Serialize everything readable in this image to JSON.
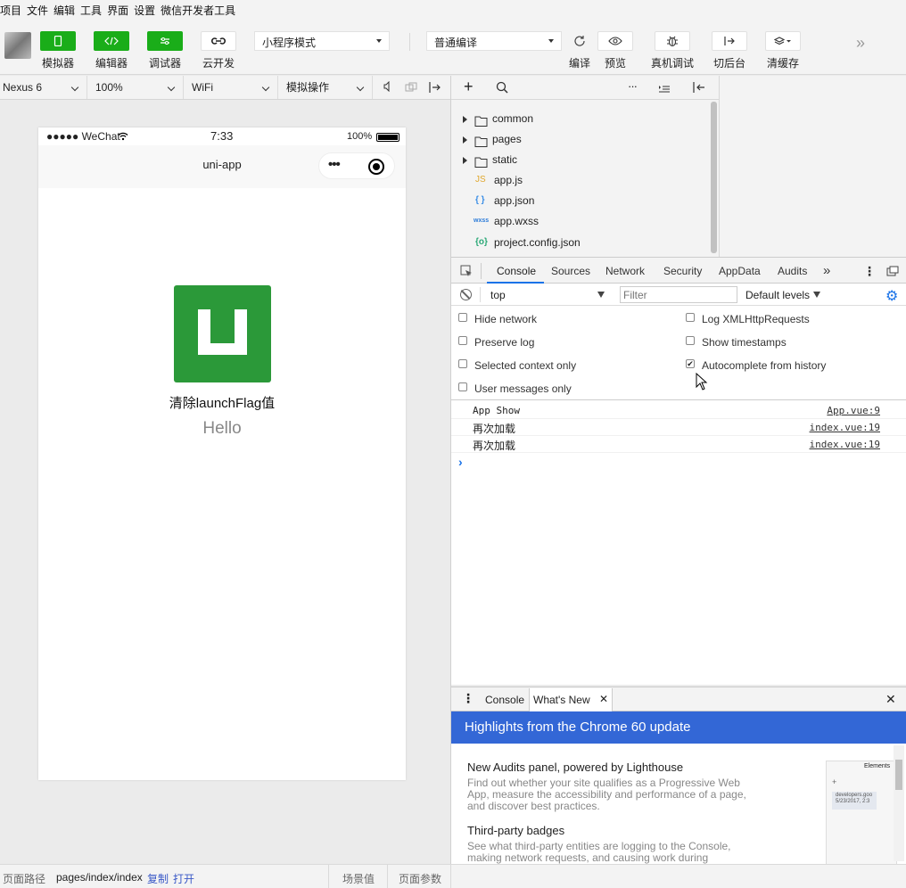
{
  "menu": [
    "项目",
    "文件",
    "编辑",
    "工具",
    "界面",
    "设置",
    "微信开发者工具"
  ],
  "toolbar": {
    "simulator": "模拟器",
    "editor": "编辑器",
    "debugger": "调试器",
    "cloud": "云开发",
    "mode_select": "小程序模式",
    "compile_select": "普通编译",
    "compile": "编译",
    "preview": "预览",
    "remote_debug": "真机调试",
    "background": "切后台",
    "clear_cache": "清缓存"
  },
  "device_bar": {
    "device": "Nexus 6",
    "zoom": "100%",
    "network": "WiFi",
    "sim_ops": "模拟操作"
  },
  "phone": {
    "carrier": "●●●●● WeChat",
    "time": "7:33",
    "battery": "100%",
    "title": "uni-app",
    "button_text": "清除launchFlag值",
    "hello": "Hello"
  },
  "file_tree": [
    {
      "name": "common",
      "type": "folder"
    },
    {
      "name": "pages",
      "type": "folder"
    },
    {
      "name": "static",
      "type": "folder"
    },
    {
      "name": "app.js",
      "type": "js",
      "badge": "JS"
    },
    {
      "name": "app.json",
      "type": "json",
      "badge": "{ }"
    },
    {
      "name": "app.wxss",
      "type": "wxss",
      "badge": "wxss"
    },
    {
      "name": "project.config.json",
      "type": "config",
      "badge": "{o}"
    }
  ],
  "devtools": {
    "tabs": [
      "Console",
      "Sources",
      "Network",
      "Security",
      "AppData",
      "Audits"
    ],
    "context": "top",
    "filter_placeholder": "Filter",
    "levels": "Default levels",
    "options_left": [
      "Hide network",
      "Preserve log",
      "Selected context only",
      "User messages only"
    ],
    "options_right": [
      "Log XMLHttpRequests",
      "Show timestamps",
      "Autocomplete from history"
    ],
    "autocomplete_checked": true,
    "logs": [
      {
        "msg": "App Show",
        "src": "App.vue:9"
      },
      {
        "msg": "再次加载",
        "src": "index.vue:19"
      },
      {
        "msg": "再次加载",
        "src": "index.vue:19"
      }
    ],
    "prompt": "›"
  },
  "drawer": {
    "tabs": [
      "Console",
      "What's New"
    ],
    "banner": "Highlights from the Chrome 60 update",
    "items": [
      {
        "title": "New Audits panel, powered by Lighthouse",
        "desc1": "Find out whether your site qualifies as a Progressive Web",
        "desc2": "App, measure the accessibility and performance of a page,",
        "desc3": "and discover best practices."
      },
      {
        "title": "Third-party badges",
        "desc1": "See what third-party entities are logging to the Console,",
        "desc2": "making network requests, and causing work during",
        "desc3": ""
      }
    ],
    "thumb_label": "Elements",
    "thumb_url": "developers.goo",
    "thumb_date": "5/23/2017, 2:3"
  },
  "bottom_bar": {
    "path_label": "页面路径",
    "path": "pages/index/index",
    "copy": "复制",
    "open": "打开",
    "scene": "场景值",
    "params": "页面参数"
  },
  "colors": {
    "green": "#1aad19",
    "banner": "#3367d6",
    "logo_green": "#2b9939",
    "link": "#3a59c7",
    "accent_blue": "#1a73e8"
  }
}
